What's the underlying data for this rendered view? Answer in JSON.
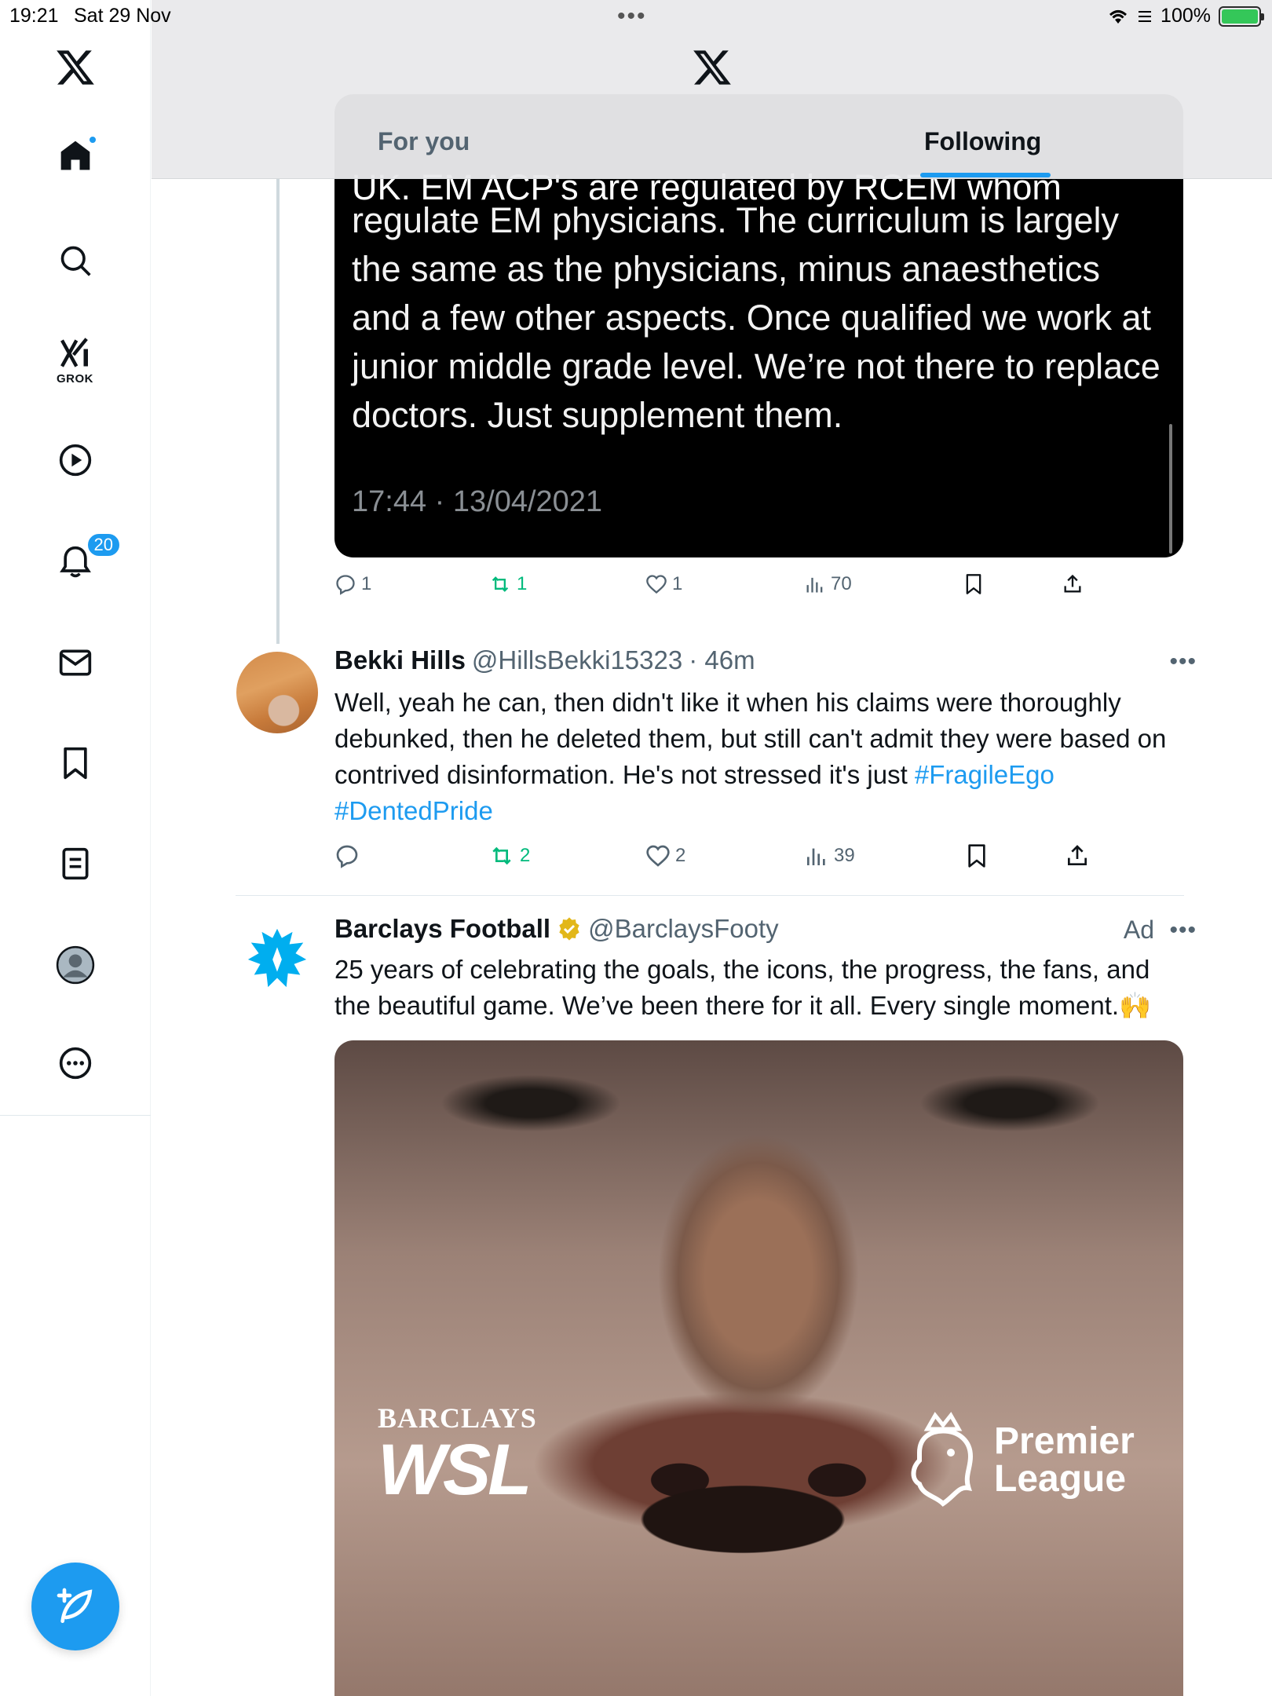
{
  "status_bar": {
    "time": "19:21",
    "date": "Sat 29 Nov",
    "battery": "100%"
  },
  "sidebar": {
    "grok_label": "GROK",
    "notifications_badge": "20",
    "items": [
      "home-icon",
      "search-icon",
      "grok-icon",
      "video-icon",
      "notifications-icon",
      "messages-icon",
      "bookmarks-icon",
      "lists-icon",
      "profile-icon",
      "more-icon"
    ]
  },
  "header": {
    "tabs": [
      {
        "label": "For you"
      },
      {
        "label": "Following"
      }
    ],
    "active_tab": "Following"
  },
  "quoted_screenshot": {
    "cut_line": "UK. EM ACP's are regulated by RCEM whom",
    "body": "regulate EM physicians. The curriculum is largely the same as the physicians, minus anaesthetics and a few other aspects. Once qualified we work at junior middle grade level. We’re not there to replace doctors. Just supplement them.",
    "timestamp": "17:44 · 13/04/2021"
  },
  "tweet1_actions": {
    "replies": "1",
    "retweets": "1",
    "likes": "1",
    "views": "70"
  },
  "tweet2": {
    "name": "Bekki Hills",
    "handle": "@HillsBekki15323",
    "time": "· 46m",
    "text_plain": "Well, yeah he can, then didn't like it when his claims were thoroughly debunked, then he deleted them, but still can't admit they were based on contrived disinformation. He's not stressed it's just",
    "hashtag1": "#FragileEgo",
    "hashtag2": "#DentedPride",
    "actions": {
      "replies": "",
      "retweets": "2",
      "likes": "2",
      "views": "39"
    }
  },
  "tweet3": {
    "name": "Barclays Football",
    "handle": "@BarclaysFooty",
    "ad_label": "Ad",
    "text": "25 years of celebrating the goals, the icons, the progress, the fans, and the beautiful game. We’ve been there for it all. Every single moment.🙌",
    "media": {
      "left_logo_top": "BARCLAYS",
      "left_logo_main": "WSL",
      "right_logo_line1": "Premier",
      "right_logo_line2": "League"
    }
  },
  "colors": {
    "accent": "#1d9bf0",
    "retweet_green": "#00ba7c",
    "secondary_text": "#536471"
  }
}
